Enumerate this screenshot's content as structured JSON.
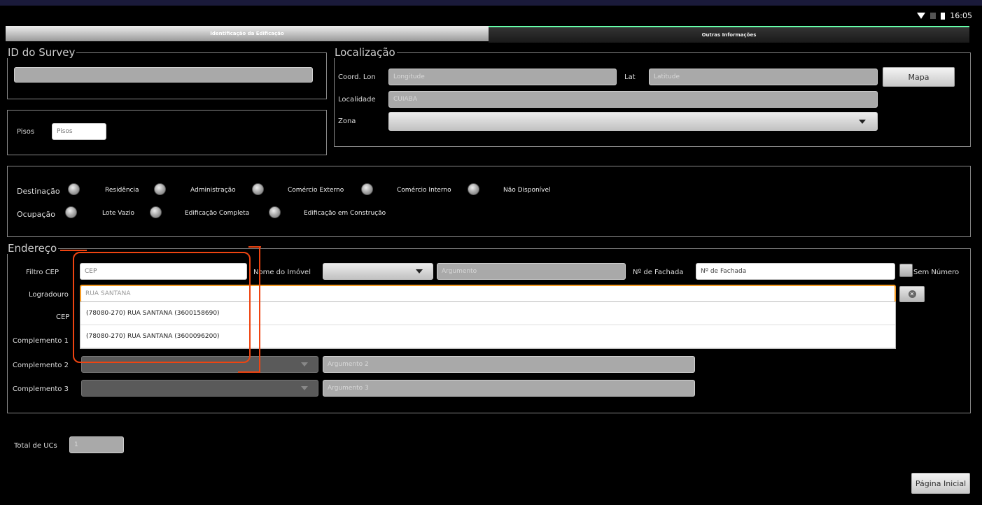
{
  "status": {
    "time": "16:05"
  },
  "tabs": [
    {
      "label": "Identificação da Edificação",
      "selected": true
    },
    {
      "label": "Outras Informações",
      "selected": false
    }
  ],
  "survey": {
    "legend": "ID do Survey",
    "value": ""
  },
  "pisos": {
    "label": "Pisos",
    "placeholder": "Pisos"
  },
  "localizacao": {
    "legend": "Localização",
    "lon_label": "Coord. Lon",
    "lon_placeholder": "Longitude",
    "lat_label": "Lat",
    "lat_placeholder": "Latitude",
    "map_button": "Mapa",
    "localidade_label": "Localidade",
    "localidade_value": "CUIABA",
    "zona_label": "Zona",
    "zona_value": ""
  },
  "destinacao": {
    "label": "Destinação",
    "options": [
      "Residência",
      "Administração",
      "Comércio Externo",
      "Comércio Interno",
      "Não Disponível"
    ]
  },
  "ocupacao": {
    "label": "Ocupação",
    "options": [
      "Lote Vazio",
      "Edificação Completa",
      "Edificação em Construção"
    ]
  },
  "endereco": {
    "legend": "Endereço",
    "filtro_cep_label": "Filtro CEP",
    "filtro_cep_value": "CEP",
    "nome_imovel_label": "Nome do Imóvel",
    "nome_imovel_value": "",
    "argumento_placeholder": "Argumento",
    "fachada_label": "Nº de Fachada",
    "fachada_placeholder": "Nº de Fachada",
    "sem_numero_label": "Sem Número",
    "logradouro_label": "Logradouro",
    "logradouro_value": "RUA SANTANA",
    "cep_label": "CEP",
    "complemento1_label": "Complemento 1",
    "complemento2_label": "Complemento 2",
    "argumento2_placeholder": "Argumento 2",
    "complemento3_label": "Complemento 3",
    "argumento3_placeholder": "Argumento 3",
    "suggestions": [
      "(78080-270) RUA SANTANA (3600158690)",
      "(78080-270) RUA SANTANA (3600096200)"
    ]
  },
  "total_ucs": {
    "label": "Total de UCs",
    "value": "1"
  },
  "home_button": "Página Inicial",
  "colors": {
    "annotation": "#e41",
    "focus": "#f59a23",
    "tab_accent": "#66ffaa"
  }
}
